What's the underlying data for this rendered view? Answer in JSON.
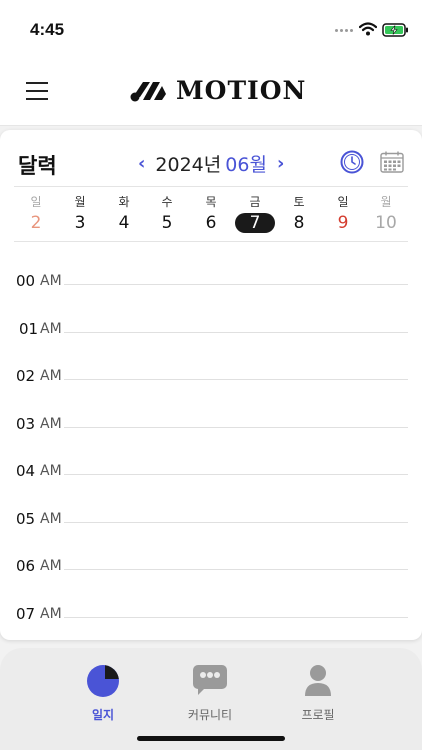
{
  "status": {
    "time": "4:45"
  },
  "header": {
    "brand": "MOTION"
  },
  "calendar": {
    "title": "달력",
    "year_label": "2024년",
    "month_label": "06월",
    "prev_chevron": "‹",
    "next_chevron": "›",
    "days": [
      {
        "weekday": "일",
        "date": "2",
        "style": "sunpast"
      },
      {
        "weekday": "월",
        "date": "3",
        "style": "normal"
      },
      {
        "weekday": "화",
        "date": "4",
        "style": "normal"
      },
      {
        "weekday": "수",
        "date": "5",
        "style": "normal"
      },
      {
        "weekday": "목",
        "date": "6",
        "style": "normal"
      },
      {
        "weekday": "금",
        "date": "7",
        "style": "selected"
      },
      {
        "weekday": "토",
        "date": "8",
        "style": "normal"
      },
      {
        "weekday": "일",
        "date": "9",
        "style": "red"
      },
      {
        "weekday": "월",
        "date": "10",
        "style": "faded"
      }
    ],
    "hours": [
      {
        "num": "00",
        "ampm": "AM"
      },
      {
        "num": "01",
        "ampm": "AM"
      },
      {
        "num": "02",
        "ampm": "AM"
      },
      {
        "num": "03",
        "ampm": "AM"
      },
      {
        "num": "04",
        "ampm": "AM"
      },
      {
        "num": "05",
        "ampm": "AM"
      },
      {
        "num": "06",
        "ampm": "AM"
      },
      {
        "num": "07",
        "ampm": "AM"
      }
    ]
  },
  "tabs": [
    {
      "label": "일지",
      "icon": "pie-chart-icon",
      "active": true
    },
    {
      "label": "커뮤니티",
      "icon": "community-chat-icon",
      "active": false
    },
    {
      "label": "프로필",
      "icon": "profile-icon",
      "active": false
    }
  ],
  "colors": {
    "accent": "#4a54d6",
    "sunday_red": "#d43c2e",
    "selected_bg": "#1a1a1a"
  }
}
